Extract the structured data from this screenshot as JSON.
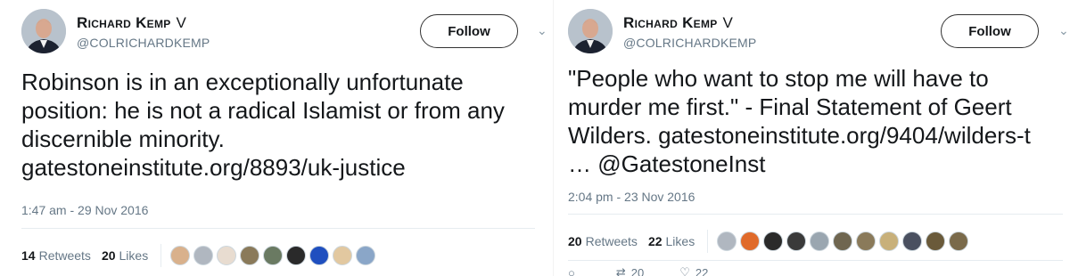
{
  "tweets": [
    {
      "author_name": "Richard Kemp",
      "verified_mark": "V",
      "handle": "@COLRICHARDKEMP",
      "follow_label": "Follow",
      "caret_icon": "chevron-down-icon",
      "text_parts": [
        "Robinson is in an exceptionally unfortunate position: he is not a radical Islamist or from any discernible minority.",
        "gatestoneinstitute.org/8893/uk-justice"
      ],
      "timestamp": "1:47 am - 29 Nov 2016",
      "retweets_count": "14",
      "retweets_label": "Retweets",
      "likes_count": "20",
      "likes_label": "Likes",
      "liker_avatar_colors": [
        "#d9b18c",
        "#b0b7c0",
        "#e8dcd0",
        "#8a7a5a",
        "#6a7a62",
        "#2a2a2a",
        "#1f4fbf",
        "#e2c8a0",
        "#8aa6c8"
      ]
    },
    {
      "author_name": "Richard Kemp",
      "verified_mark": "V",
      "handle": "@COLRICHARDKEMP",
      "follow_label": "Follow",
      "caret_icon": "chevron-down-icon",
      "text_parts": [
        "\"People who want to stop me will have to murder me first.\" - Final Statement of Geert Wilders.",
        "gatestoneinstitute.org/9404/wilders-t",
        "… @GatestoneInst"
      ],
      "timestamp": "2:04 pm - 23 Nov 2016",
      "retweets_count": "20",
      "retweets_label": "Retweets",
      "likes_count": "22",
      "likes_label": "Likes",
      "liker_avatar_colors": [
        "#b0b7c0",
        "#e06a2a",
        "#2a2a2a",
        "#3a3a3a",
        "#9aa6b0",
        "#6f6650",
        "#8a7a5a",
        "#c8b07a",
        "#4a5060",
        "#6a5a3a",
        "#7a6a4a"
      ],
      "actions": [
        {
          "icon": "reply-icon",
          "count": ""
        },
        {
          "icon": "retweet-icon",
          "count": "20"
        },
        {
          "icon": "heart-icon",
          "count": "22"
        }
      ]
    }
  ]
}
